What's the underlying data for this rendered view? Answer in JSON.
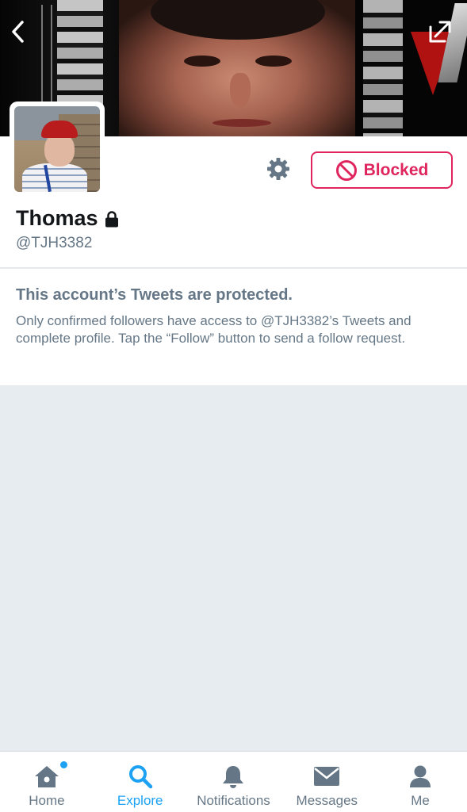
{
  "header": {
    "back_icon": "chevron-left-icon",
    "share_icon": "share-icon"
  },
  "profile": {
    "name": "Thomas",
    "handle": "@TJH3382",
    "protected_icon": "lock-icon",
    "settings_icon": "gear-icon",
    "blocked_label": "Blocked",
    "blocked_color": "#e0245e"
  },
  "notice": {
    "title": "This account’s Tweets are protected.",
    "body": "Only confirmed followers have access to @TJH3382’s Tweets and complete profile. Tap the “Follow” button to send a follow request."
  },
  "tabbar": {
    "active_color": "#1da1f2",
    "items": [
      {
        "label": "Home",
        "icon": "home-icon",
        "badge_dot": true
      },
      {
        "label": "Explore",
        "icon": "search-icon",
        "active": true
      },
      {
        "label": "Notifications",
        "icon": "bell-icon"
      },
      {
        "label": "Messages",
        "icon": "envelope-icon"
      },
      {
        "label": "Me",
        "icon": "person-icon"
      }
    ]
  }
}
